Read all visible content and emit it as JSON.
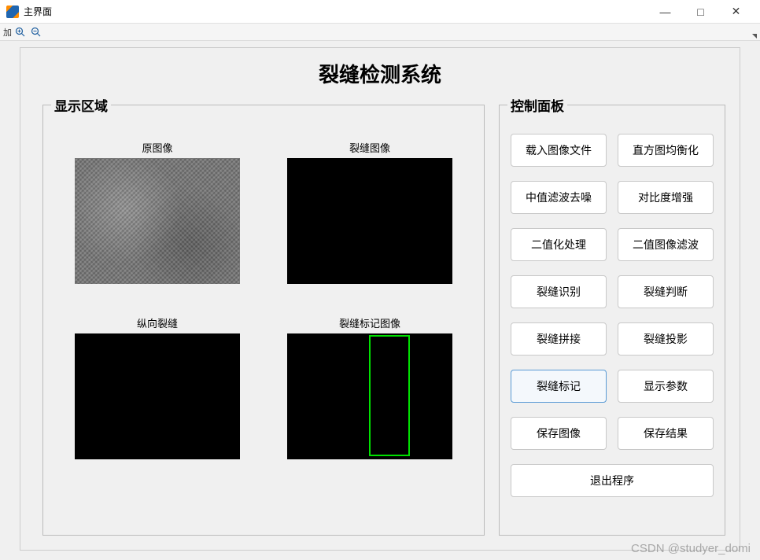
{
  "window": {
    "title": "主界面",
    "min": "—",
    "max": "□",
    "close": "✕"
  },
  "toolbar": {
    "left_label": "加"
  },
  "app_title": "裂缝检测系统",
  "display_panel": {
    "legend": "显示区域",
    "images": {
      "original": "原图像",
      "crack": "裂缝图像",
      "vertical": "纵向裂缝",
      "marked": "裂缝标记图像"
    }
  },
  "control_panel": {
    "legend": "控制面板",
    "buttons": {
      "load": "载入图像文件",
      "histeq": "直方图均衡化",
      "median": "中值滤波去噪",
      "contrast": "对比度增强",
      "binarize": "二值化处理",
      "binfilter": "二值图像滤波",
      "recognize": "裂缝识别",
      "judge": "裂缝判断",
      "stitch": "裂缝拼接",
      "project": "裂缝投影",
      "mark": "裂缝标记",
      "params": "显示参数",
      "saveimg": "保存图像",
      "saveres": "保存结果",
      "exit": "退出程序"
    },
    "active_button": "mark"
  },
  "watermark": "CSDN @studyer_domi"
}
